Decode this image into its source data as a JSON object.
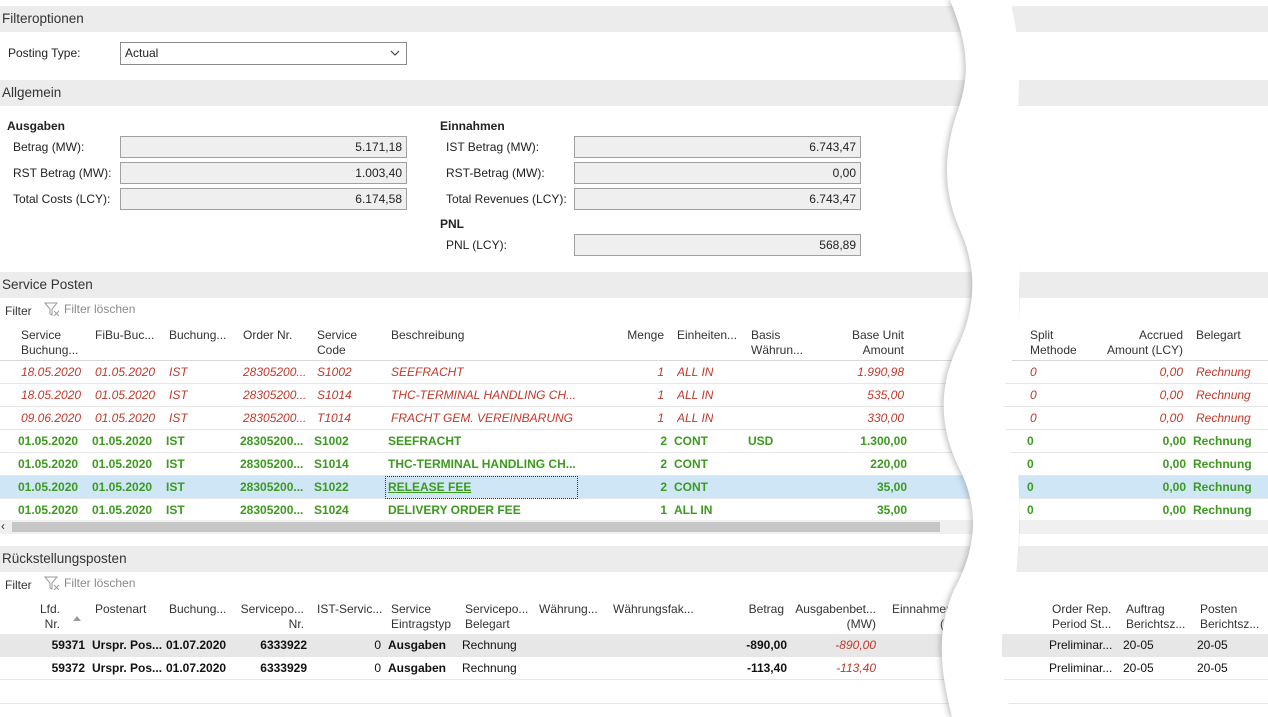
{
  "filter": {
    "section_title": "Filteroptionen",
    "posting_type_label": "Posting Type:",
    "posting_type_value": "Actual"
  },
  "general": {
    "section_title": "Allgemein",
    "expenses": {
      "header": "Ausgaben",
      "amount_label": "Betrag (MW):",
      "amount_value": "5.171,18",
      "rst_label": "RST Betrag (MW):",
      "rst_value": "1.003,40",
      "total_label": "Total Costs (LCY):",
      "total_value": "6.174,58"
    },
    "income": {
      "header": "Einnahmen",
      "amount_label": "IST Betrag (MW):",
      "amount_value": "6.743,47",
      "rst_label": "RST-Betrag (MW):",
      "rst_value": "0,00",
      "total_label": "Total Revenues (LCY):",
      "total_value": "6.743,47"
    },
    "pnl": {
      "header": "PNL",
      "label": "PNL (LCY):",
      "value": "568,89"
    }
  },
  "service": {
    "section_title": "Service Posten",
    "filter_label": "Filter",
    "clear_filter_label": "Filter löschen",
    "columns": {
      "c1": [
        "Service",
        "Buchung..."
      ],
      "c2": "FiBu-Buc...",
      "c3": "Buchung...",
      "c4": "Order Nr.",
      "c5": [
        "Service",
        "Code"
      ],
      "c6": "Beschreibung",
      "c7": "Menge",
      "c8": "Einheiten...",
      "c9": [
        "Basis",
        "Währun..."
      ],
      "c10": [
        "Base Unit",
        "Amount"
      ],
      "c11": "..",
      "c12": [
        "Split",
        "Methode"
      ],
      "c13": [
        "Accrued",
        "Amount (LCY)"
      ],
      "c14": "Belegart"
    },
    "rows": [
      [
        "18.05.2020",
        "01.05.2020",
        "IST",
        "28305200...",
        "S1002",
        "SEEFRACHT",
        "1",
        "ALL IN",
        "",
        "1.990,98",
        "0",
        "0,00",
        "Rechnung"
      ],
      [
        "18.05.2020",
        "01.05.2020",
        "IST",
        "28305200...",
        "S1014",
        "THC-TERMINAL HANDLING CH...",
        "1",
        "ALL IN",
        "",
        "535,00",
        "0",
        "0,00",
        "Rechnung"
      ],
      [
        "09.06.2020",
        "01.05.2020",
        "IST",
        "28305200...",
        "T1014",
        "FRACHT GEM. VEREINBARUNG",
        "1",
        "ALL IN",
        "",
        "330,00",
        "0",
        "0,00",
        "Rechnung"
      ],
      [
        "01.05.2020",
        "01.05.2020",
        "IST",
        "28305200...",
        "S1002",
        "SEEFRACHT",
        "2",
        "CONT",
        "USD",
        "1.300,00",
        "0",
        "0,00",
        "Rechnung"
      ],
      [
        "01.05.2020",
        "01.05.2020",
        "IST",
        "28305200...",
        "S1014",
        "THC-TERMINAL HANDLING CH...",
        "2",
        "CONT",
        "",
        "220,00",
        "0",
        "0,00",
        "Rechnung"
      ],
      [
        "01.05.2020",
        "01.05.2020",
        "IST",
        "28305200...",
        "S1022",
        "RELEASE FEE",
        "2",
        "CONT",
        "",
        "35,00",
        "0",
        "0,00",
        "Rechnung"
      ],
      [
        "01.05.2020",
        "01.05.2020",
        "IST",
        "28305200...",
        "S1024",
        "DELIVERY ORDER FEE",
        "1",
        "ALL IN",
        "",
        "35,00",
        "0",
        "0,00",
        "Rechnung"
      ]
    ]
  },
  "accruals": {
    "section_title": "Rückstellungsposten",
    "filter_label": "Filter",
    "clear_filter_label": "Filter löschen",
    "columns": {
      "c1": [
        "Lfd.",
        "Nr."
      ],
      "c2": "Postenart",
      "c3": "Buchung...",
      "c4": [
        "Servicepo...",
        "Nr."
      ],
      "c5": "IST-Servic...",
      "c6": [
        "Service",
        "Eintragstyp"
      ],
      "c7": [
        "Servicepo...",
        "Belegart"
      ],
      "c8": "Währung...",
      "c9": "Währungsfak...",
      "c10": "Betrag",
      "c11": [
        "Ausgabenbet...",
        "(MW)"
      ],
      "c12": [
        "Einnahmen",
        "(M"
      ],
      "c13": [
        "Order Rep.",
        "Period St..."
      ],
      "c14": [
        "Auftrag",
        "Berichtsz..."
      ],
      "c15": [
        "Posten",
        "Berichtsz..."
      ]
    },
    "rows": [
      [
        "59371",
        "Urspr. Pos...",
        "01.07.2020",
        "6333922",
        "0",
        "Ausgaben",
        "Rechnung",
        "-890,00",
        "-890,00",
        "Preliminar...",
        "20-05",
        "20-05"
      ],
      [
        "59372",
        "Urspr. Pos...",
        "01.07.2020",
        "6333929",
        "0",
        "Ausgaben",
        "Rechnung",
        "-113,40",
        "-113,40",
        "Preliminar...",
        "20-05",
        "20-05"
      ]
    ]
  }
}
